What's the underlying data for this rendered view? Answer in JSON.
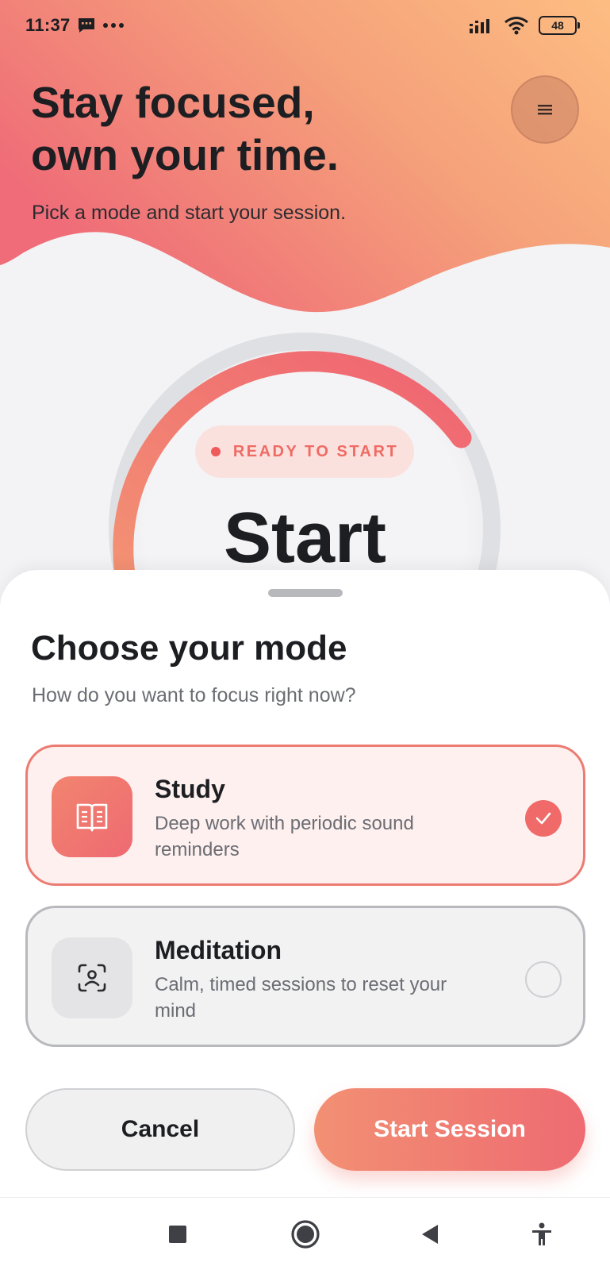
{
  "status_bar": {
    "time": "11:37",
    "notification_icons": [
      "message-icon",
      "more-dots-icon"
    ],
    "system_icons": [
      "signal-icon",
      "wifi-icon",
      "battery-icon"
    ],
    "battery_level": "48"
  },
  "hero": {
    "title_line1": "Stay focused,",
    "title_line2": "own your time.",
    "subtitle": "Pick a mode and start your session.",
    "menu_icon": "menu-icon"
  },
  "timer": {
    "status_label": "READY TO START",
    "main_label": "Start",
    "progress_fraction": 0.2
  },
  "sheet": {
    "title": "Choose your mode",
    "subtitle": "How do you want to focus right now?",
    "modes": [
      {
        "name": "Study",
        "description": "Deep work with periodic sound reminders",
        "icon": "book-icon",
        "selected": true
      },
      {
        "name": "Meditation",
        "description": "Calm, timed sessions to reset your mind",
        "icon": "face-scan-icon",
        "selected": false
      }
    ],
    "cancel_label": "Cancel",
    "start_label": "Start Session"
  },
  "nav_bar": {
    "items": [
      "recents-icon",
      "home-icon",
      "back-icon",
      "accessibility-icon"
    ]
  },
  "colors": {
    "accent": "#ef6a68",
    "gradient_start": "#f0707a",
    "gradient_end": "#fcba80",
    "text_primary": "#1d1e22",
    "text_secondary": "#6b6d73"
  }
}
